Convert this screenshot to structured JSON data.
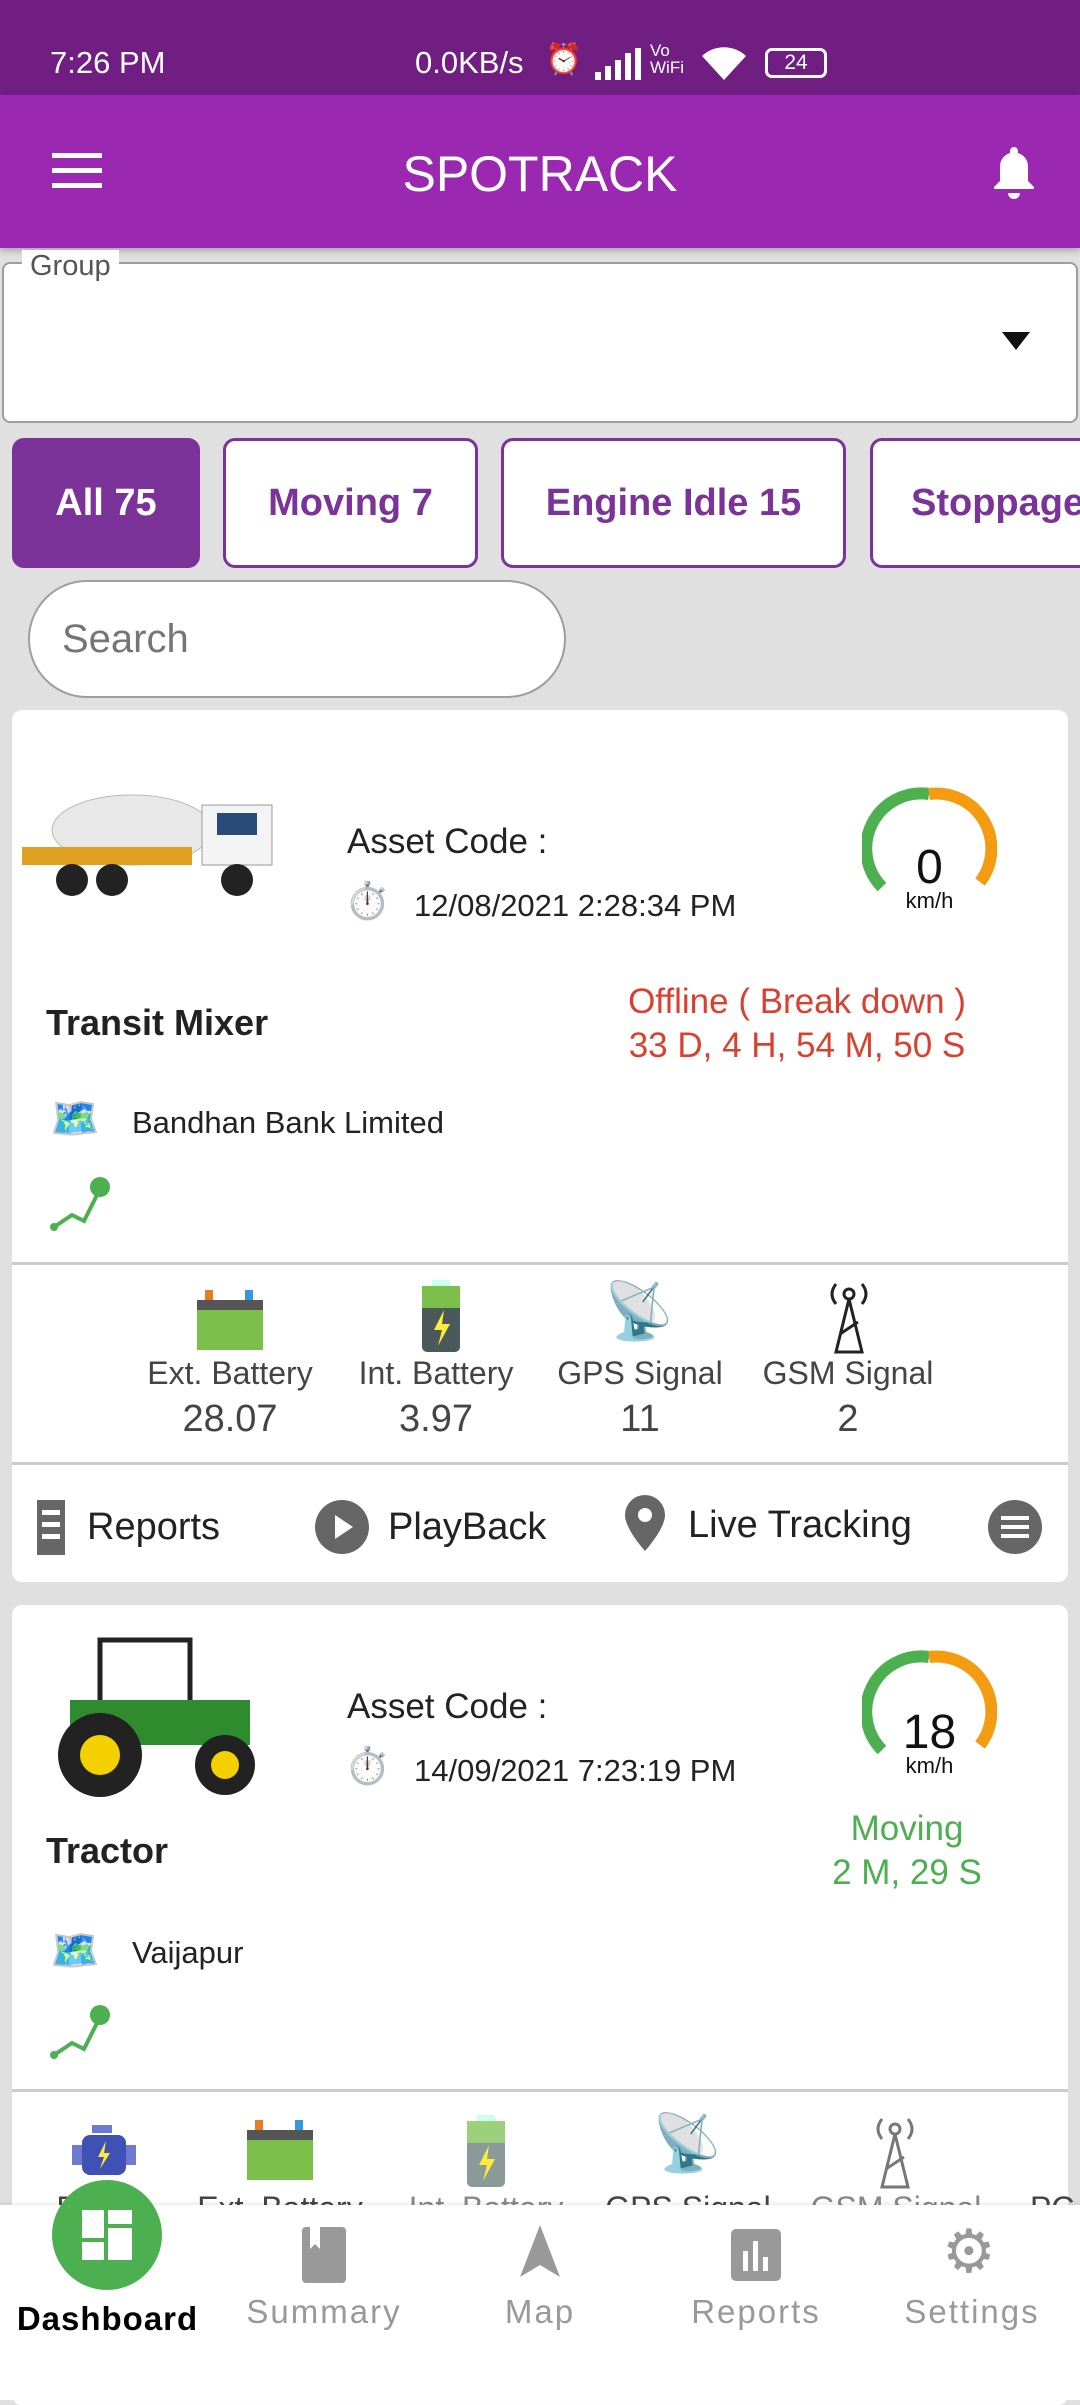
{
  "status_bar": {
    "time": "7:26 PM",
    "network_speed": "0.0KB/s",
    "vowifi": "Vo WiFi",
    "battery": "24"
  },
  "app_bar": {
    "title": "SPOTRACK"
  },
  "group": {
    "label": "Group",
    "value": ""
  },
  "filters": [
    {
      "label": "All 75",
      "active": true
    },
    {
      "label": "Moving 7",
      "active": false
    },
    {
      "label": "Engine Idle 15",
      "active": false
    },
    {
      "label": "Stoppage",
      "active": false
    }
  ],
  "search": {
    "placeholder": "Search"
  },
  "vehicles": [
    {
      "name": "Transit Mixer",
      "asset_code_label": "Asset Code :",
      "datetime": "12/08/2021 2:28:34 PM",
      "speed": "0",
      "speed_unit": "km/h",
      "status": "Offline ( Break down )",
      "duration": "33 D, 4 H, 54 M, 50 S",
      "status_color": "#d9412f",
      "location": "Bandhan Bank Limited",
      "sensors": [
        {
          "label": "Ext. Battery",
          "value": "28.07"
        },
        {
          "label": "Int. Battery",
          "value": "3.97"
        },
        {
          "label": "GPS Signal",
          "value": "11"
        },
        {
          "label": "GSM Signal",
          "value": "2"
        }
      ],
      "actions": {
        "reports": "Reports",
        "playback": "PlayBack",
        "live_tracking": "Live Tracking"
      }
    },
    {
      "name": "Tractor",
      "asset_code_label": "Asset Code :",
      "datetime": "14/09/2021 7:23:19 PM",
      "speed": "18",
      "speed_unit": "km/h",
      "status": "Moving",
      "duration": "2 M, 29 S",
      "status_color": "#4caf50",
      "location": "Vaijapur",
      "sensors": [
        {
          "label": "E"
        },
        {
          "label": "Ext. Battery"
        },
        {
          "label": "Int. Battery"
        },
        {
          "label": "GPS Signal"
        },
        {
          "label": "GSM Signal"
        },
        {
          "label": "PC"
        }
      ]
    }
  ],
  "bottom_nav": [
    {
      "label": "Dashboard",
      "active": true
    },
    {
      "label": "Summary"
    },
    {
      "label": "Map"
    },
    {
      "label": "Reports"
    },
    {
      "label": "Settings"
    }
  ],
  "colors": {
    "primary": "#9a28b0",
    "status_bar": "#701e82",
    "chip": "#7b3399",
    "active_nav": "#4caf50"
  }
}
